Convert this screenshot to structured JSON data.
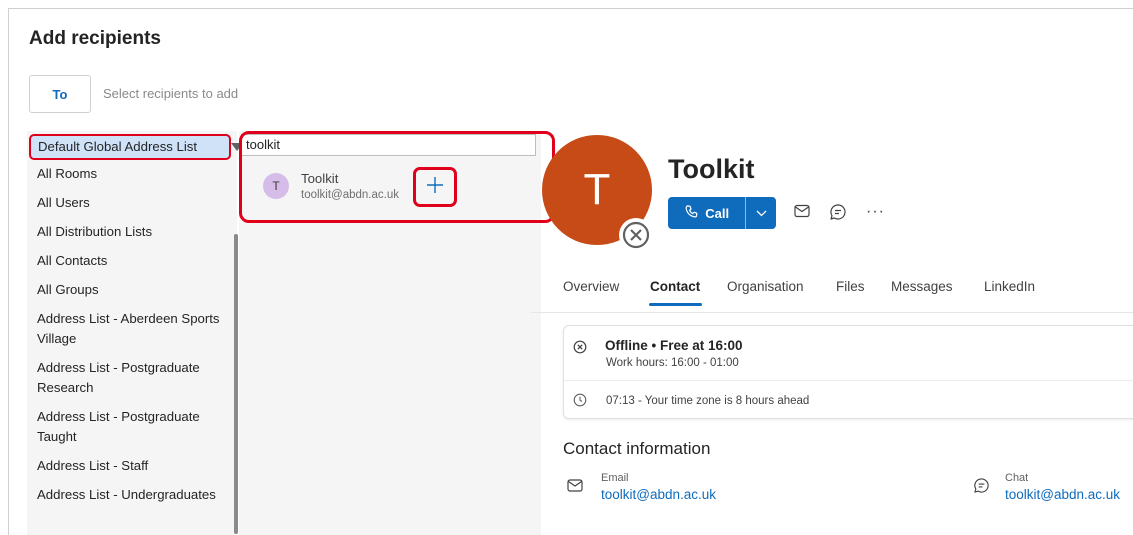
{
  "dialog": {
    "title": "Add recipients",
    "to_button": "To",
    "recipients_placeholder": "Select recipients to add"
  },
  "address_lists": {
    "selected": "Default Global Address List",
    "items": [
      "All Rooms",
      "All Users",
      "All Distribution Lists",
      "All Contacts",
      "All Groups",
      "Address List - Aberdeen Sports Village",
      "Address List - Postgraduate Research",
      "Address List - Postgraduate Taught",
      "Address List - Staff",
      "Address List - Undergraduates"
    ]
  },
  "search": {
    "query": "toolkit",
    "results": [
      {
        "initial": "T",
        "name": "Toolkit",
        "email": "toolkit@abdn.ac.uk",
        "avatar_color": "#d6bde9"
      }
    ]
  },
  "contact": {
    "initial": "T",
    "avatar_color": "#c74b16",
    "name": "Toolkit",
    "call_label": "Call",
    "tabs": [
      "Overview",
      "Contact",
      "Organisation",
      "Files",
      "Messages",
      "LinkedIn"
    ],
    "active_tab": "Contact",
    "availability": {
      "status": "Offline • Free at 16:00",
      "work_hours": "Work hours: 16:00 - 01:00",
      "local_time": "07:13 - Your time zone is 8 hours ahead"
    },
    "info_heading": "Contact information",
    "email_label": "Email",
    "email": "toolkit@abdn.ac.uk",
    "chat_label": "Chat",
    "chat": "toolkit@abdn.ac.uk"
  },
  "colors": {
    "accent": "#0f6cbd",
    "highlight_red": "#e0001b",
    "selected_bg": "#cfe2f8"
  }
}
